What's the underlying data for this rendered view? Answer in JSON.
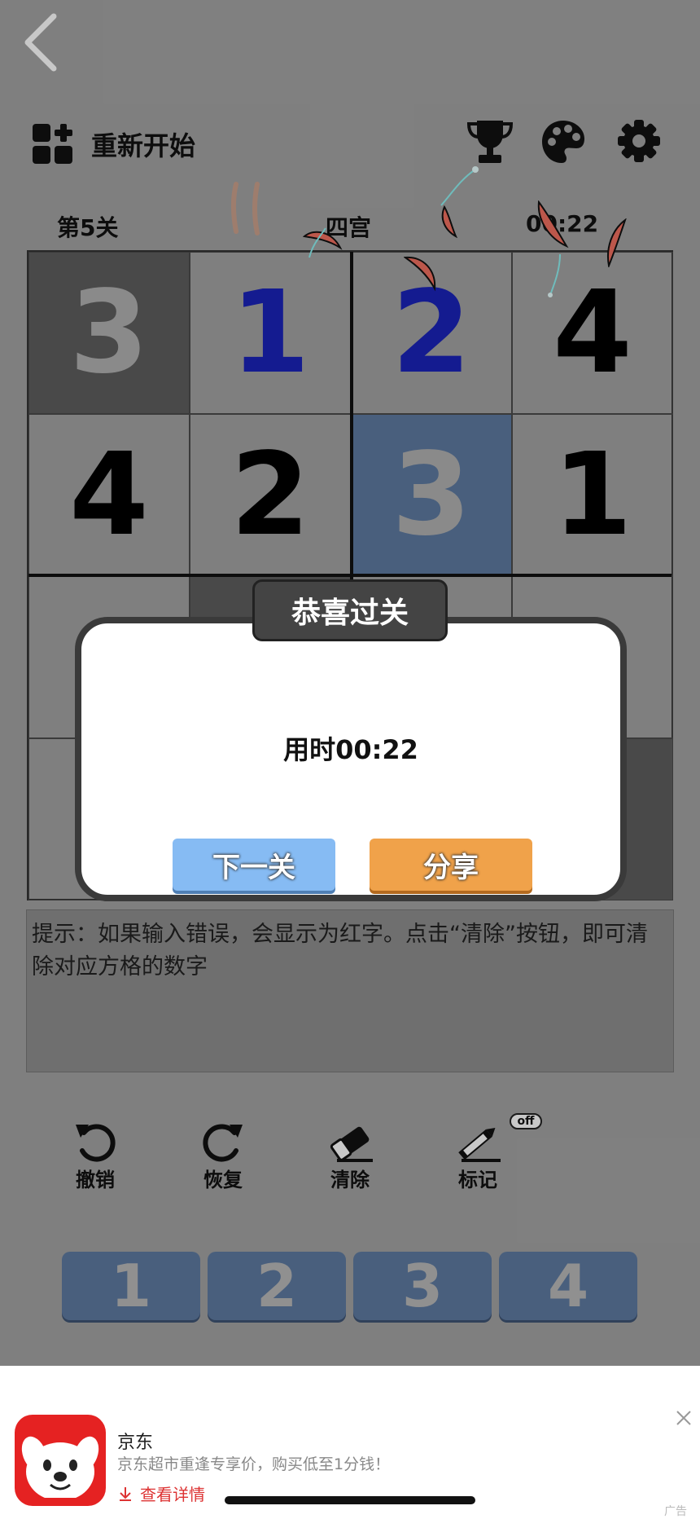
{
  "header": {
    "back_icon": "chevron-left-icon",
    "restart_label": "重新开始",
    "icons": [
      "trophy-icon",
      "palette-icon",
      "gear-icon"
    ]
  },
  "info": {
    "level": "第5关",
    "mode": "四宫",
    "timer": "00:22"
  },
  "board": {
    "rows": [
      [
        {
          "v": "3",
          "state": "selected"
        },
        {
          "v": "1",
          "state": "user"
        },
        {
          "v": "2",
          "state": "user"
        },
        {
          "v": "4",
          "state": "given"
        }
      ],
      [
        {
          "v": "4",
          "state": "given"
        },
        {
          "v": "2",
          "state": "given"
        },
        {
          "v": "3",
          "state": "highlight"
        },
        {
          "v": "1",
          "state": "given"
        }
      ],
      [
        {
          "v": "",
          "state": "empty"
        },
        {
          "v": "",
          "state": "dark"
        },
        {
          "v": "",
          "state": "empty"
        },
        {
          "v": "",
          "state": "empty"
        }
      ],
      [
        {
          "v": "",
          "state": "empty"
        },
        {
          "v": "",
          "state": "empty"
        },
        {
          "v": "",
          "state": "empty"
        },
        {
          "v": "",
          "state": "dark"
        }
      ]
    ]
  },
  "hint": "提示：如果输入错误，会显示为红字。点击“清除”按钮，即可清除对应方格的数字",
  "tools": {
    "undo": "撤销",
    "redo": "恢复",
    "clear": "清除",
    "mark": "标记",
    "mark_state": "off"
  },
  "numpad": [
    "1",
    "2",
    "3",
    "4"
  ],
  "dialog": {
    "title": "恭喜过关",
    "time_text": "用时00:22",
    "next_label": "下一关",
    "share_label": "分享"
  },
  "ad": {
    "brand": "京东",
    "description": "京东超市重逢专享价，购买低至1分钱！",
    "link_label": "查看详情",
    "tag": "广告"
  },
  "colors": {
    "background": "#a3a3a3",
    "overlay": "rgba(0,0,0,0.215)",
    "user_digit": "#1a23b8",
    "next_button": "#86bbf3",
    "share_button": "#f0a24a",
    "numpad": "#5d7aa0",
    "ad_link": "#dd3333"
  }
}
